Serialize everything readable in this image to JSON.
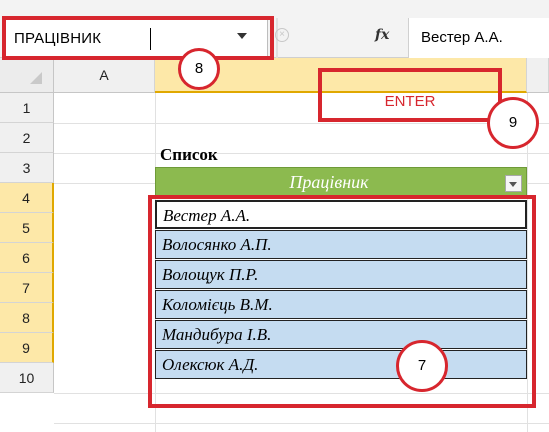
{
  "formula_bar": {
    "name_box_value": "ПРАЦІВНИК",
    "cancel_glyph": "×",
    "fx_label": "fx",
    "formula_value": "Вестер А.А."
  },
  "grid": {
    "columns": [
      "A",
      ""
    ],
    "rows": [
      "1",
      "2",
      "3",
      "4",
      "5",
      "6",
      "7",
      "8",
      "9",
      "10"
    ],
    "title": "Список",
    "table_header": "Працівник",
    "employees": [
      "Вестер А.А.",
      "Волосянко А.П.",
      "Волощук П.Р.",
      "Коломієць В.М.",
      "Мандибура І.В.",
      "Олексюк А.Д."
    ]
  },
  "callouts": {
    "name_box_step": "8",
    "enter_label": "ENTER",
    "enter_step": "9",
    "range_step": "7"
  },
  "colors": {
    "callout_red": "#d7262e",
    "table_header_green": "#8cba4f",
    "selection_blue": "#c5dcf1",
    "header_highlight": "#fde8a8"
  },
  "icons": [
    "dropdown-arrow-icon",
    "cancel-icon",
    "fx-icon",
    "select-all-icon",
    "filter-arrow-icon"
  ]
}
